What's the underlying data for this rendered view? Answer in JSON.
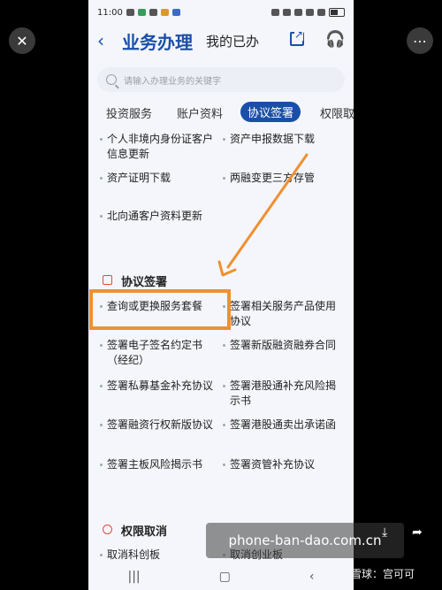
{
  "status": {
    "time": "11:00"
  },
  "header": {
    "title": "业务办理",
    "my_work": "我的已办"
  },
  "search": {
    "placeholder": "请输入办理业务的关键字"
  },
  "tabs": [
    "投资服务",
    "账户资料",
    "协议签署",
    "权限取"
  ],
  "account_items": [
    "个人非境内身份证客户信息更新",
    "资产申报数据下载",
    "资产证明下载",
    "两融变更三方存管",
    "北向通客户资料更新"
  ],
  "agreement": {
    "title": "协议签署",
    "items": [
      "查询或更换服务套餐",
      "签署相关服务产品使用协议",
      "签署电子签名约定书（经纪）",
      "签署新版融资融券合同",
      "签署私募基金补充协议",
      "签署港股通补充风险揭示书",
      "签署融资行权新版协议",
      "签署港股通卖出承诺函",
      "签署主板风险揭示书",
      "签署资管补充协议"
    ]
  },
  "permission": {
    "title": "权限取消",
    "items": [
      "取消科创板",
      "取消创业板"
    ]
  },
  "overlay": {
    "watermark": "phone-ban-dao.com.cn",
    "brand": "雪球：宫可可"
  }
}
